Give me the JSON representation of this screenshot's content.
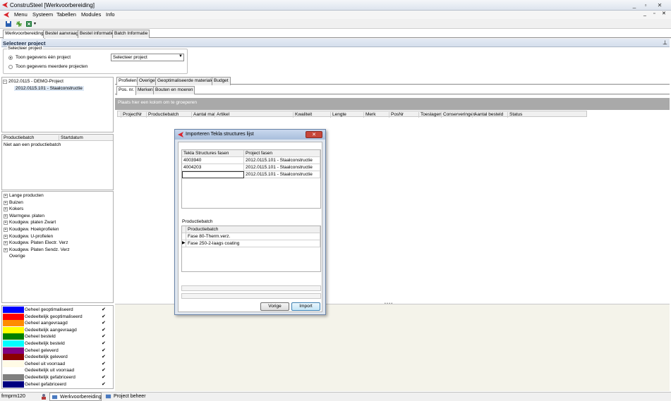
{
  "window": {
    "title": "ConstruSteel [Werkvoorbereiding]",
    "min": "_",
    "restore": "▫",
    "close": "✕"
  },
  "menu": [
    "Menu",
    "Systeem",
    "Tabellen",
    "Modules",
    "Info"
  ],
  "main_tabs": [
    "Werkvoorbereiding",
    "Bestel aanvraag",
    "Bestel informatie",
    "Batch Informatie"
  ],
  "header": {
    "title": "Selecteer project",
    "pin": "⊥"
  },
  "project_group": {
    "legend": "Selecteer project",
    "radio1": "Toon gegevens één project",
    "radio2": "Toon gegevens meerdere projecten",
    "select_value": "Selecteer project"
  },
  "tree": {
    "root": "2012.0115 - DEMO-Project",
    "child": "2012.0115.101 - Staalconstructie"
  },
  "batch_grid": {
    "col1": "Productiebatch",
    "col2": "Startdatum",
    "row1": "Niet aan een productiebatch"
  },
  "categories": [
    "Lange producten",
    "Buizen",
    "Kokers",
    "Warmgew. platen",
    "Koudgew. platen Zwart",
    "Koudgew. Hoekprofielen",
    "Koudgew. U-profielen",
    "Koudgew. Platen Electr. Verz",
    "Koudgew. Platen Sendz. Verz",
    "Overige"
  ],
  "status_legend": [
    {
      "label": "Geheel geoptimaliseerd",
      "color": "#0000ff"
    },
    {
      "label": "Gedeeltelijk geoptimaliseerd",
      "color": "#ff0000"
    },
    {
      "label": "Geheel aangevraagd",
      "color": "#ff8c00"
    },
    {
      "label": "Gedeeltelijk aangevraagd",
      "color": "#ffff00"
    },
    {
      "label": "Geheel besteld",
      "color": "#008000"
    },
    {
      "label": "Gedeeltelijk besteld",
      "color": "#00ffff"
    },
    {
      "label": "Geheel geleverd",
      "color": "#800080"
    },
    {
      "label": "Gedeeltelijk geleverd",
      "color": "#8b0000"
    },
    {
      "label": "Geheel uit voorraad",
      "color": "#fffbe6"
    },
    {
      "label": "Gedeeltelijk uit voorraad",
      "color": "#ffffff"
    },
    {
      "label": "Gedeeltelijk gefabriceerd",
      "color": "#808080"
    },
    {
      "label": "Geheel gefabriceerd",
      "color": "#000080"
    }
  ],
  "check": "✔",
  "right_tabs": [
    "Profielen",
    "Overige",
    "Geoptimaliseerde materialen",
    "Budget"
  ],
  "sub_tabs": [
    "Pos. nr.",
    "Merken",
    "Bouten en moeren"
  ],
  "group_hint": "Plaats hier een kolom om te groeperen",
  "grid_columns": [
    "ProjectNr",
    "Productiebatch",
    "Aantal mat",
    "Artikel",
    "Kwaliteit",
    "Lengte",
    "Merk",
    "PosNr",
    "Toeslagen",
    "Conserveringen",
    "Aantal besteld",
    "Status"
  ],
  "dialog": {
    "title": "Importeren Tekla structures lijst",
    "close": "✕",
    "table1": {
      "headers": [
        "Tekla Structures fasen",
        "Project fasen"
      ],
      "rows": [
        [
          "4003940",
          "2012.0115.101 - Staalconstructie"
        ],
        [
          "4004203",
          "2012.0115.101 - Staalconstructie"
        ],
        [
          "",
          "2012.0115.101 - Staalconstructie"
        ]
      ]
    },
    "section_label": "Productiebatch",
    "table2": {
      "header": "Productiebatch",
      "rows": [
        "Fase 80-Therm.verz.",
        "Fase 250-2-laags coating"
      ]
    },
    "btn_back": "Vorige",
    "btn_import": "Import"
  },
  "statusbar": {
    "form": "frmprm120",
    "task1": "Werkvoorbereiding",
    "task2": "Project beheer"
  }
}
